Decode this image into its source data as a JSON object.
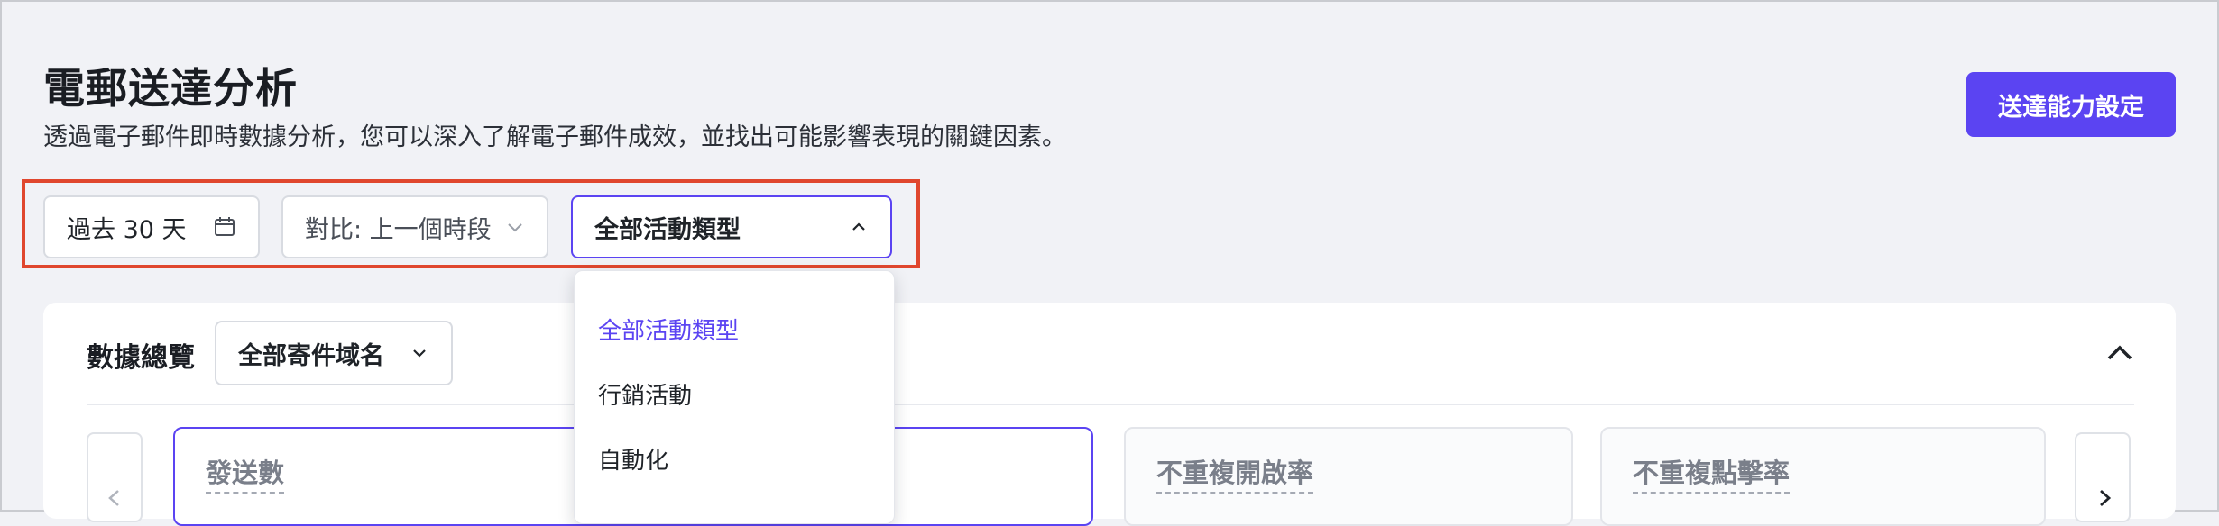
{
  "header": {
    "title": "電郵送達分析",
    "subtitle": "透過電子郵件即時數據分析，您可以深入了解電子郵件成效，並找出可能影響表現的關鍵因素。",
    "settings_button": "送達能力設定"
  },
  "filters": {
    "date_range": "過去 30 天",
    "compare": "對比: 上一個時段",
    "campaign_type": "全部活動類型"
  },
  "dropdown": {
    "options": [
      "全部活動類型",
      "行銷活動",
      "自動化"
    ],
    "selected": "全部活動類型"
  },
  "overview": {
    "title": "數據總覽",
    "domain_filter": "全部寄件域名",
    "metrics": [
      "發送數",
      "不重複開啟率",
      "不重複點擊率"
    ]
  },
  "colors": {
    "accent": "#5b44f2",
    "highlight": "#e0472e"
  },
  "icons": [
    "calendar-icon",
    "chevron-down-icon",
    "chevron-up-icon",
    "chevron-left-icon",
    "chevron-right-icon"
  ]
}
